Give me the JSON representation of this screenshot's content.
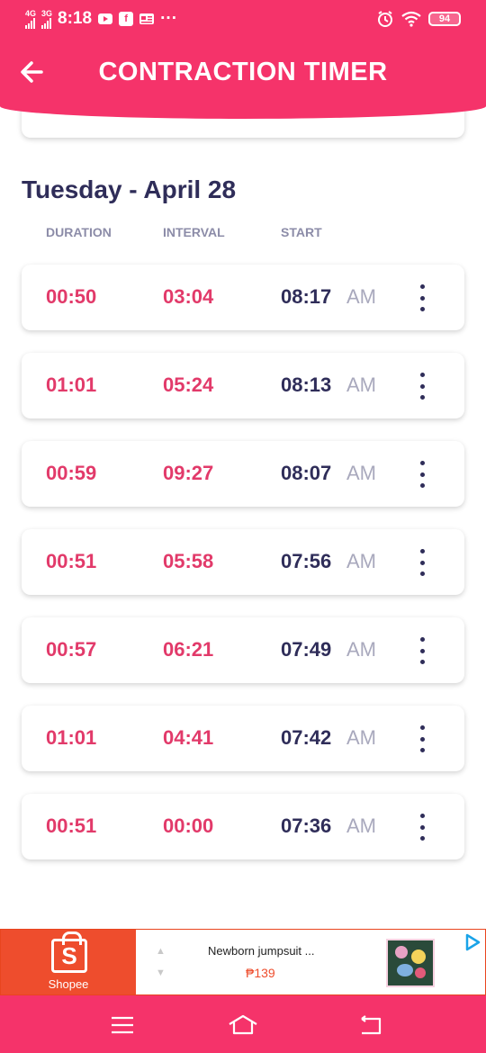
{
  "status_bar": {
    "network_1": "4G",
    "network_2": "3G",
    "time": "8:18",
    "more": "···",
    "battery": "94",
    "icons": [
      "youtube-icon",
      "facebook-icon",
      "news-icon",
      "alarm-icon",
      "wifi-icon",
      "battery-icon"
    ]
  },
  "header": {
    "title": "CONTRACTION TIMER",
    "back_icon": "arrow-left-icon"
  },
  "day": {
    "heading": "Tuesday - April 28",
    "columns": {
      "duration": "DURATION",
      "interval": "INTERVAL",
      "start": "START"
    }
  },
  "rows": [
    {
      "duration": "00:50",
      "interval": "03:04",
      "start": "08:17",
      "ampm": "AM"
    },
    {
      "duration": "01:01",
      "interval": "05:24",
      "start": "08:13",
      "ampm": "AM"
    },
    {
      "duration": "00:59",
      "interval": "09:27",
      "start": "08:07",
      "ampm": "AM"
    },
    {
      "duration": "00:51",
      "interval": "05:58",
      "start": "07:56",
      "ampm": "AM"
    },
    {
      "duration": "00:57",
      "interval": "06:21",
      "start": "07:49",
      "ampm": "AM"
    },
    {
      "duration": "01:01",
      "interval": "04:41",
      "start": "07:42",
      "ampm": "AM"
    },
    {
      "duration": "00:51",
      "interval": "00:00",
      "start": "07:36",
      "ampm": "AM"
    }
  ],
  "ad": {
    "brand": "Shopee",
    "logo_letter": "S",
    "title": "Newborn jumpsuit ...",
    "price": "₱139"
  },
  "colors": {
    "accent": "#f5336a",
    "value_pink": "#e23a6a",
    "text_dark": "#2f2d59",
    "muted": "#8c8ca8",
    "shopee": "#ee4d2d"
  }
}
